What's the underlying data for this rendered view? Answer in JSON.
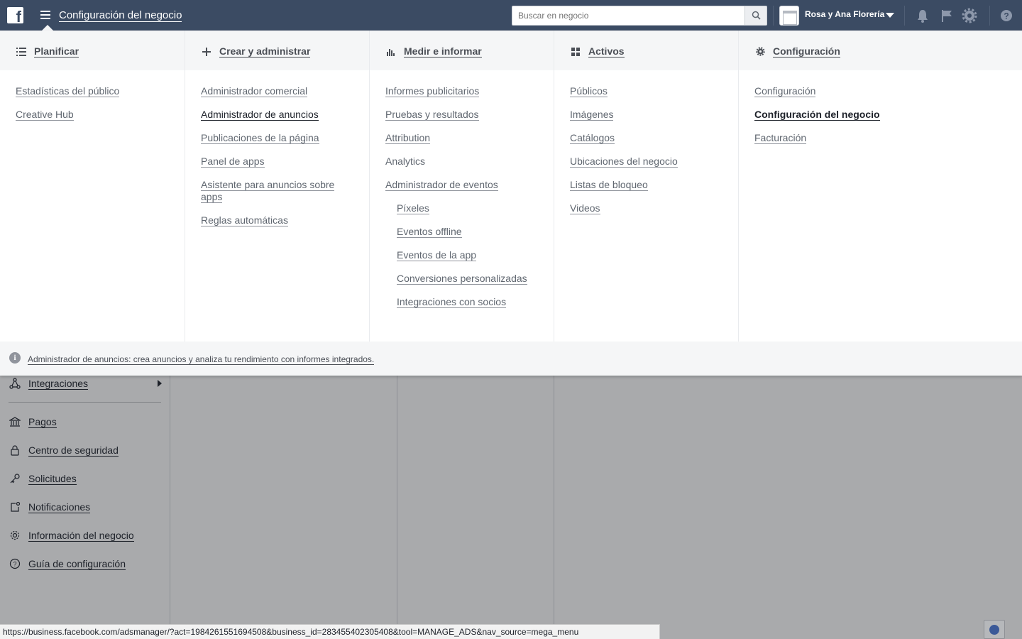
{
  "topbar": {
    "title": "Configuración del negocio",
    "search_placeholder": "Buscar en negocio",
    "account_name": "Rosa y Ana Florería"
  },
  "menu": {
    "columns": [
      {
        "title": "Planificar",
        "icon": "list-icon",
        "links": [
          {
            "label": "Estadísticas del público"
          },
          {
            "label": "Creative Hub"
          }
        ]
      },
      {
        "title": "Crear y administrar",
        "icon": "plus-icon",
        "links": [
          {
            "label": "Administrador comercial"
          },
          {
            "label": "Administrador de anuncios"
          },
          {
            "label": "Publicaciones de la página"
          },
          {
            "label": "Panel de apps"
          },
          {
            "label": "Asistente para anuncios sobre apps"
          },
          {
            "label": "Reglas automáticas"
          }
        ]
      },
      {
        "title": "Medir e informar",
        "icon": "bar-chart-icon",
        "links": [
          {
            "label": "Informes publicitarios"
          },
          {
            "label": "Pruebas y resultados"
          },
          {
            "label": "Attribution"
          },
          {
            "label": "Analytics"
          },
          {
            "label": "Administrador de eventos"
          },
          {
            "label": "Píxeles"
          },
          {
            "label": "Eventos offline"
          },
          {
            "label": "Eventos de la app"
          },
          {
            "label": "Conversiones personalizadas"
          },
          {
            "label": "Integraciones con socios"
          }
        ]
      },
      {
        "title": "Activos",
        "icon": "grid-icon",
        "links": [
          {
            "label": "Públicos"
          },
          {
            "label": "Imágenes"
          },
          {
            "label": "Catálogos"
          },
          {
            "label": "Ubicaciones del negocio"
          },
          {
            "label": "Listas de bloqueo"
          },
          {
            "label": "Videos"
          }
        ]
      },
      {
        "title": "Configuración",
        "icon": "gear-icon",
        "links": [
          {
            "label": "Configuración"
          },
          {
            "label": "Configuración del negocio"
          },
          {
            "label": "Facturación"
          }
        ]
      }
    ],
    "footer_text": "Administrador de anuncios: crea anuncios y analiza tu rendimiento con informes integrados."
  },
  "sidebar": {
    "items": [
      {
        "label": "Integraciones",
        "icon": "network-icon"
      },
      {
        "label": "Pagos",
        "icon": "bank-icon"
      },
      {
        "label": "Centro de seguridad",
        "icon": "lock-icon"
      },
      {
        "label": "Solicitudes",
        "icon": "key-icon"
      },
      {
        "label": "Notificaciones",
        "icon": "notification-icon"
      },
      {
        "label": "Información del negocio",
        "icon": "gear-icon"
      },
      {
        "label": "Guía de configuración",
        "icon": "help-icon"
      }
    ]
  },
  "statusbar": {
    "url": "https://business.facebook.com/adsmanager/?act=1984261551694508&business_id=283455402305408&tool=MANAGE_ADS&nav_source=mega_menu"
  }
}
